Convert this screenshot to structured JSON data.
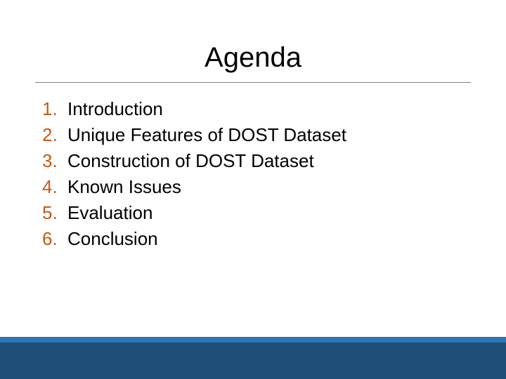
{
  "slide": {
    "title": "Agenda",
    "items": [
      {
        "number": "1.",
        "text": "Introduction"
      },
      {
        "number": "2.",
        "text": "Unique Features of DOST Dataset"
      },
      {
        "number": "3.",
        "text": "Construction of DOST Dataset"
      },
      {
        "number": "4.",
        "text": "Known Issues"
      },
      {
        "number": "5.",
        "text": "Evaluation"
      },
      {
        "number": "6.",
        "text": "Conclusion"
      }
    ]
  }
}
